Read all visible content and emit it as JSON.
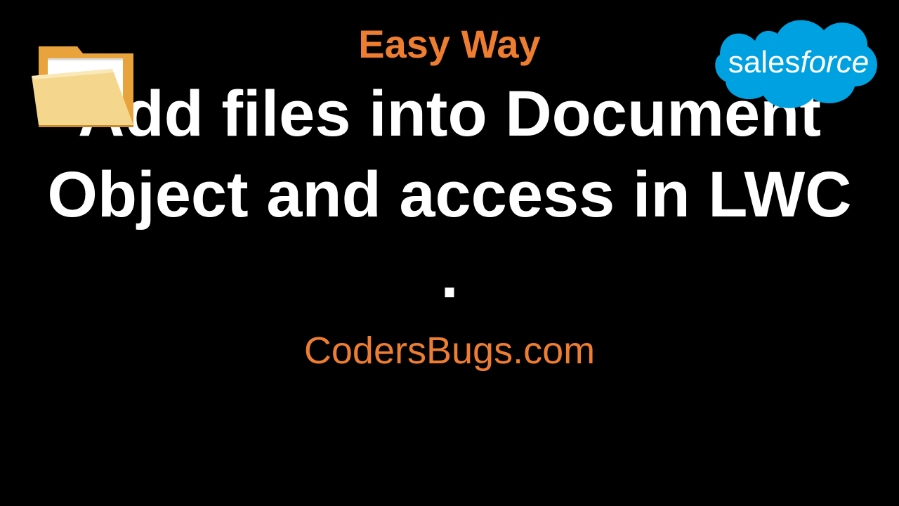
{
  "subtitle": "Easy Way",
  "main_title": "Add files into Document Object and access in LWC .",
  "website": "CodersBugs.com",
  "logo_text_part1": "sales",
  "logo_text_part2": "force"
}
